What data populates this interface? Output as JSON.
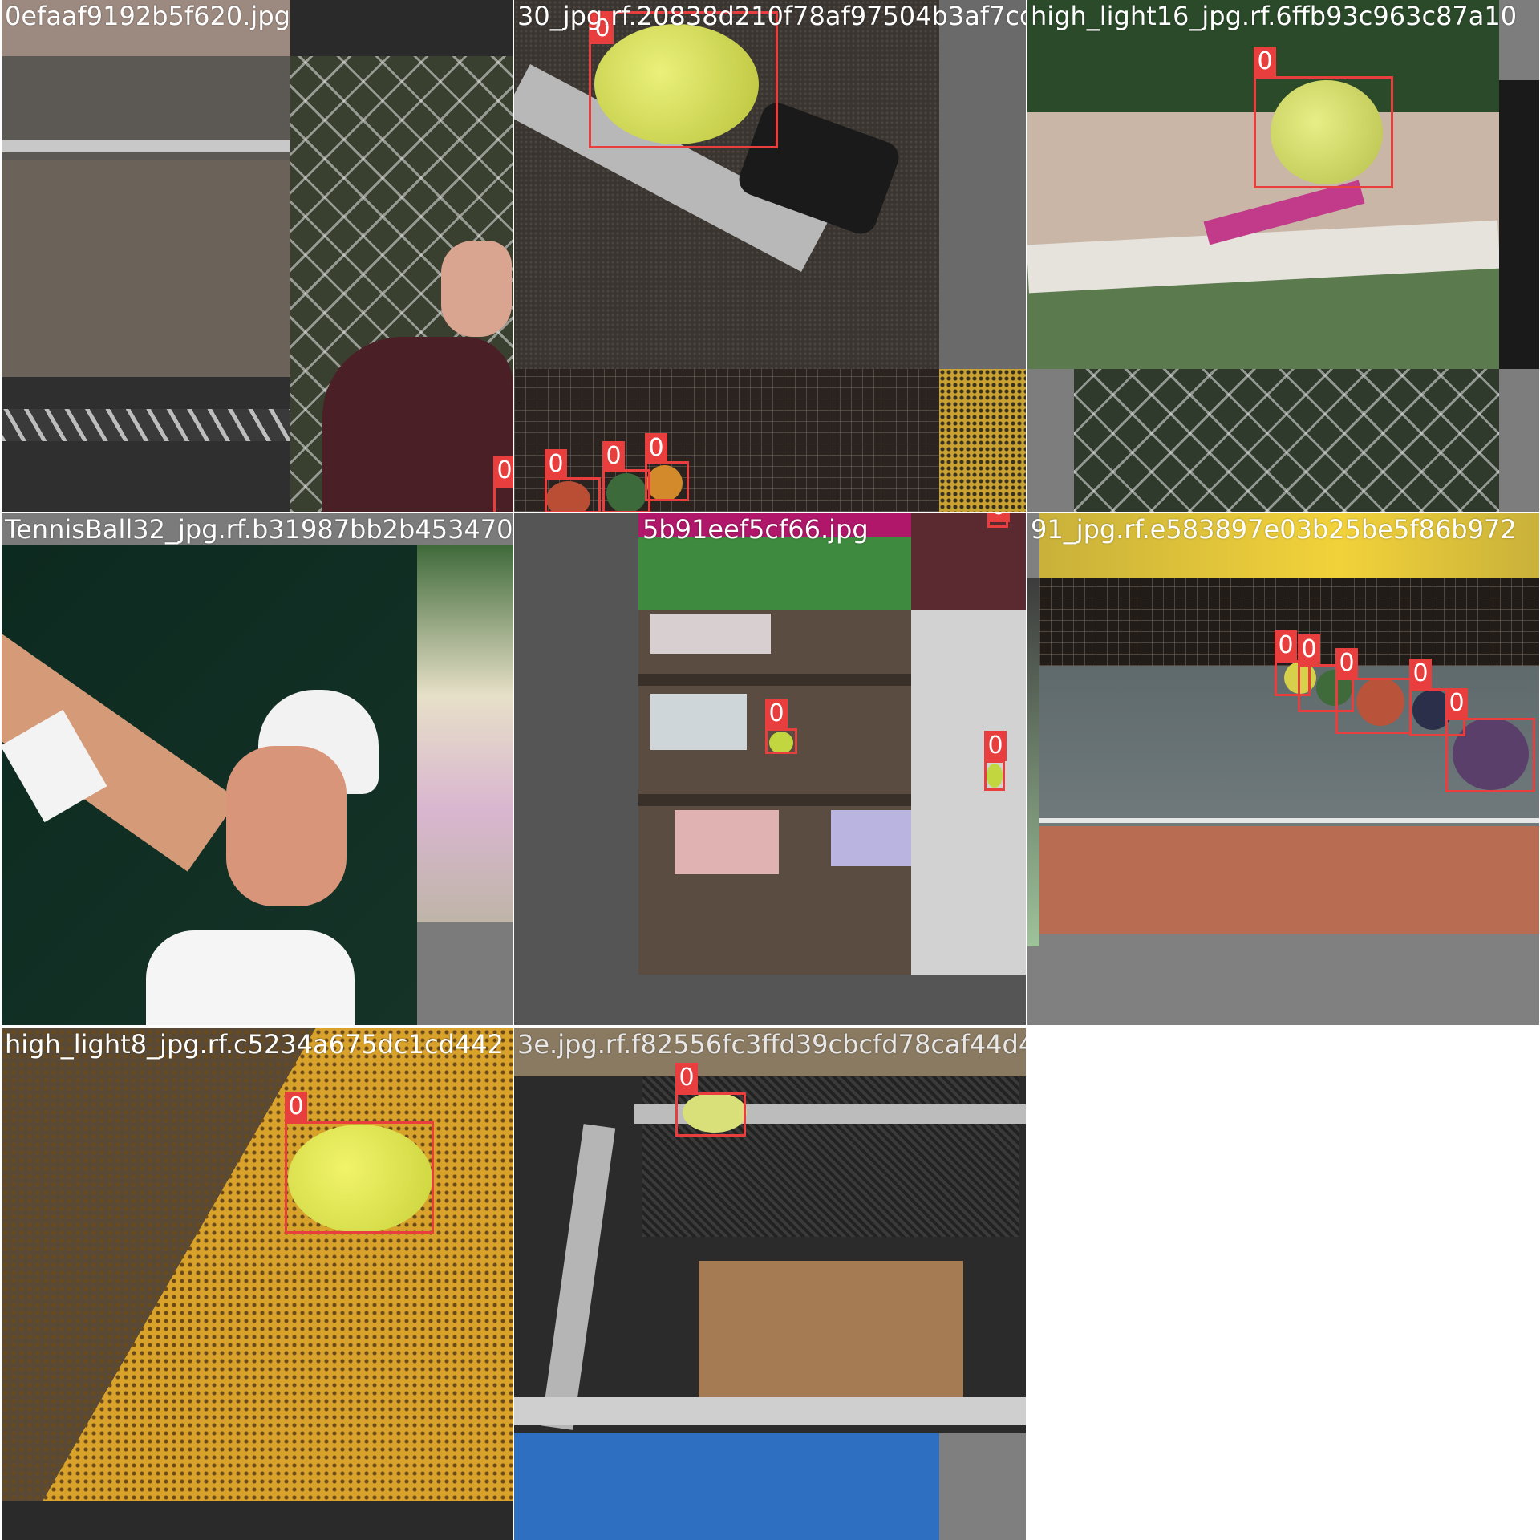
{
  "tiles": [
    {
      "filename": "0efaaf9192b5f620.jpg",
      "labels": [
        "0",
        "0",
        "0",
        "0",
        "0"
      ]
    },
    {
      "filename": "30_jpg.rf.20838d210f78af97504b3af7cd1159",
      "labels": [
        "0"
      ]
    },
    {
      "filename": "high_light16_jpg.rf.6ffb93c963c87a10",
      "labels": [
        "0"
      ]
    },
    {
      "filename": "TennisBall32_jpg.rf.b31987bb2b4534706820",
      "labels": []
    },
    {
      "filename": "5b91eef5cf66.jpg",
      "labels": [
        "0",
        "0",
        "0"
      ]
    },
    {
      "filename": "91_jpg.rf.e583897e03b25be5f86b972",
      "labels": [
        "0",
        "0",
        "0",
        "0",
        "0"
      ]
    },
    {
      "filename": "high_light8_jpg.rf.c5234a675dc1cd442",
      "labels": [
        "0"
      ]
    },
    {
      "filename": "3e.jpg.rf.f82556fc3ffd39cbcfd78caf44d427",
      "labels": [
        "0"
      ]
    }
  ],
  "colors": {
    "box": "#e83e3e",
    "filename_text": "#ffffff",
    "pad_gray": "#808080"
  }
}
